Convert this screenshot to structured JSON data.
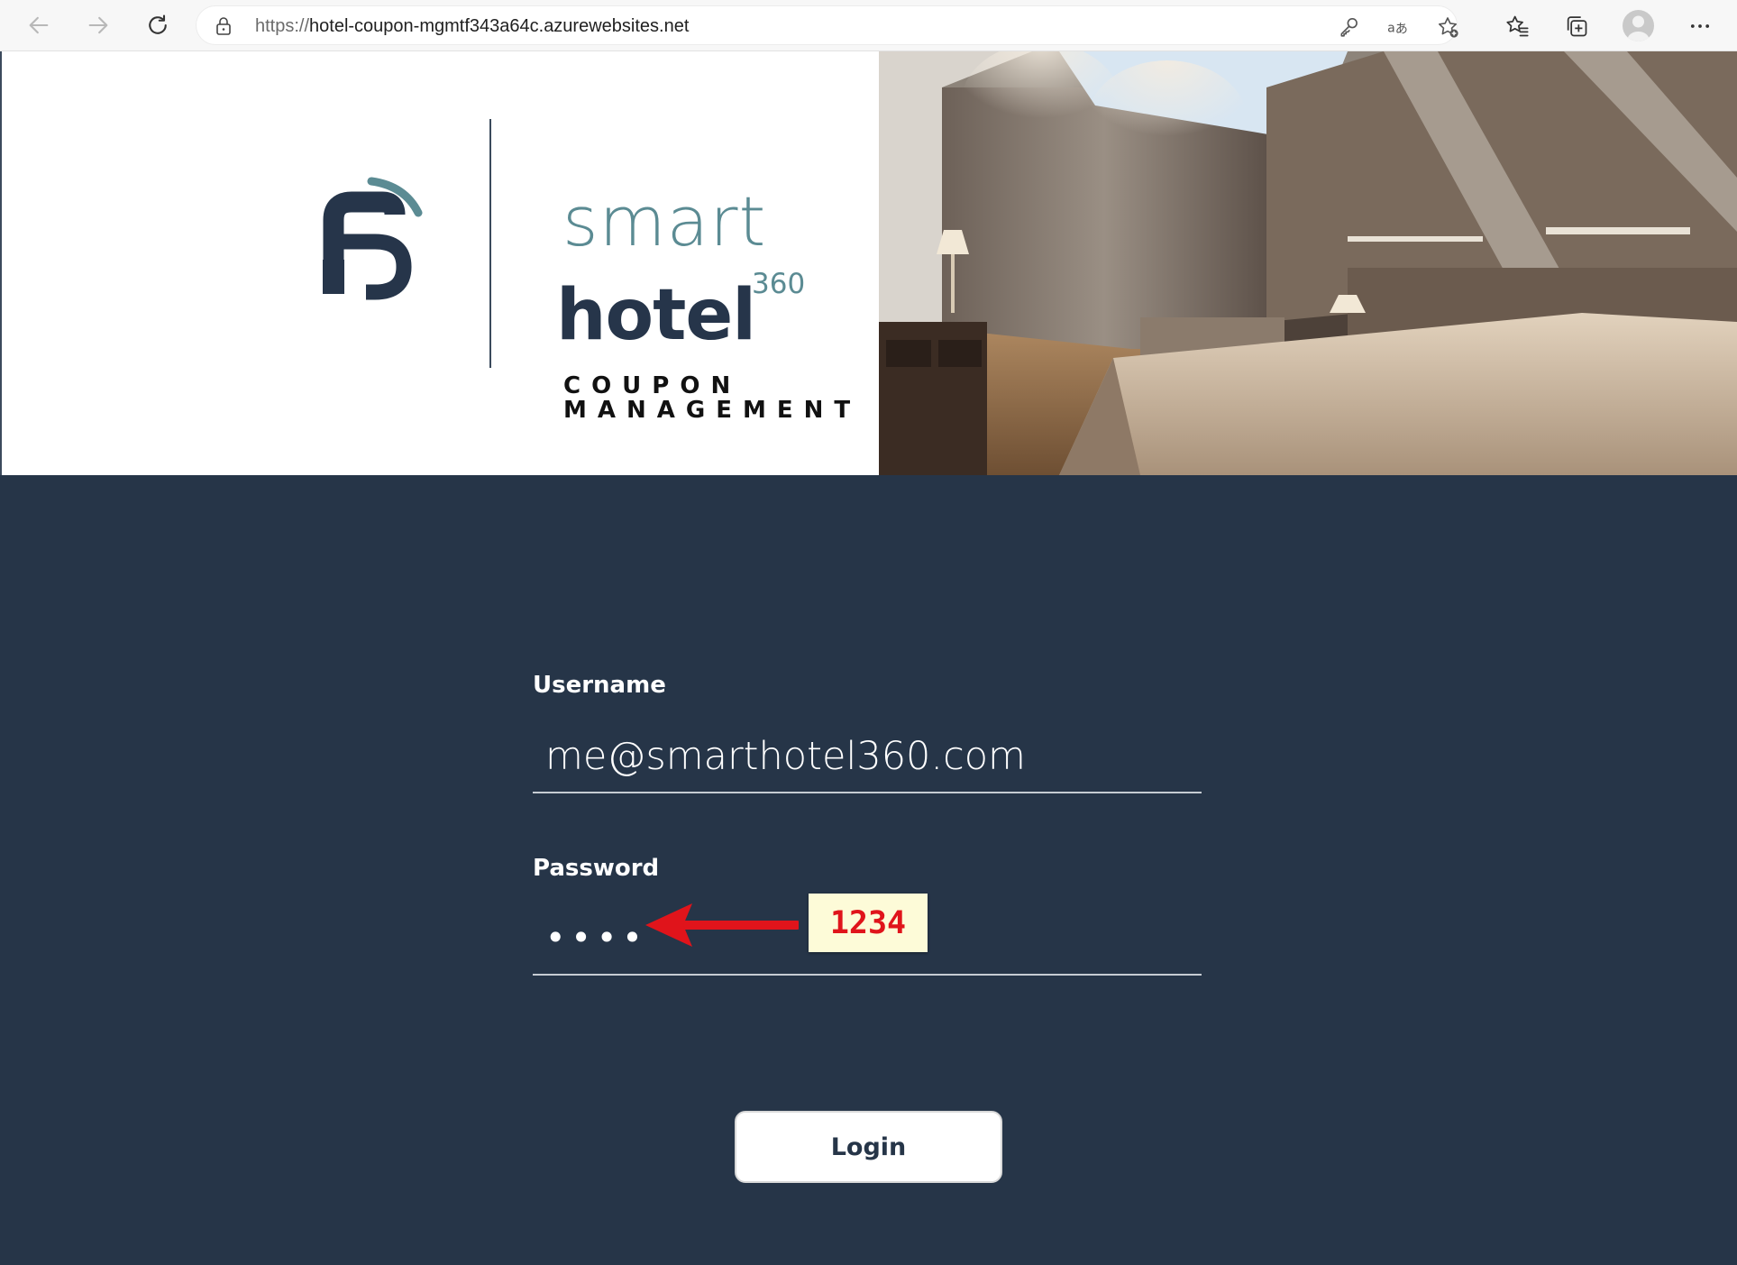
{
  "browser": {
    "url_scheme": "https://",
    "url_host": "hotel-coupon-mgmtf343a64c.azurewebsites.net",
    "icons": {
      "back": "back-arrow-icon",
      "forward": "forward-arrow-icon",
      "refresh": "refresh-icon",
      "lock": "lock-icon",
      "key": "key-icon",
      "translate": "translate-icon",
      "add_favorite": "add-favorite-icon",
      "favorites": "favorites-icon",
      "collections": "collections-icon",
      "profile": "profile-avatar",
      "more": "more-icon"
    }
  },
  "brand": {
    "smart": "smart",
    "hotel": "hotel",
    "number": "360",
    "coupon": "COUPON",
    "management": "MANAGEMENT",
    "colors": {
      "teal": "#5b8b93",
      "navy": "#26354a"
    }
  },
  "form": {
    "username_label": "Username",
    "username_value": "me@smarthotel360.com",
    "password_label": "Password",
    "password_value": "1234",
    "login_label": "Login"
  },
  "annotation": {
    "text": "1234",
    "color": "#e0141b"
  },
  "theme": {
    "background": "#263548"
  }
}
